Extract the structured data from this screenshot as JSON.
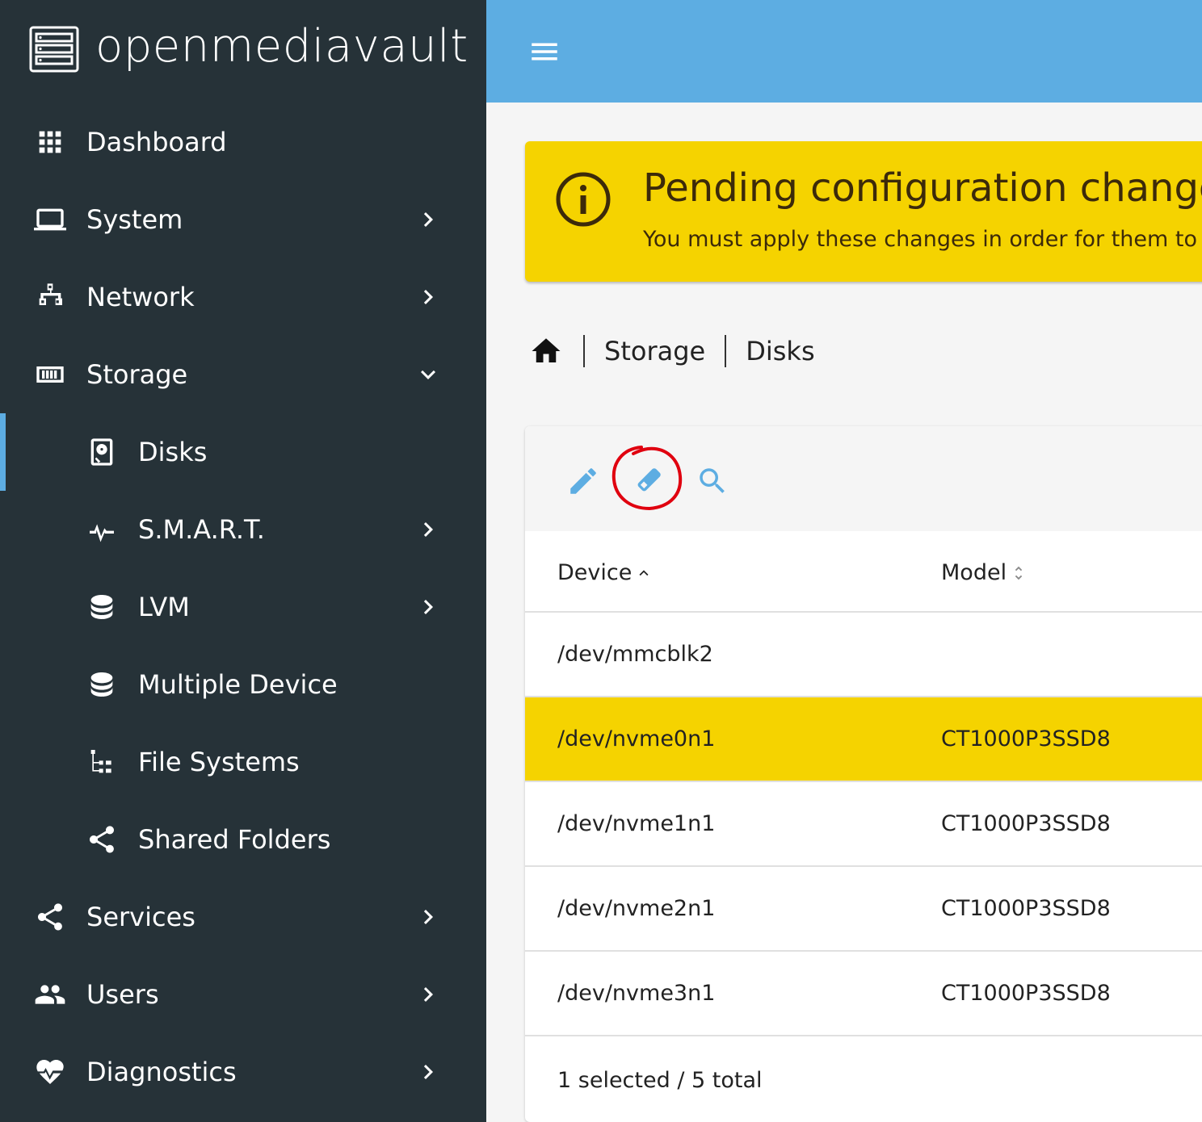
{
  "brand": {
    "name": "openmediavault"
  },
  "sidebar": {
    "items": [
      {
        "label": "Dashboard",
        "icon": "dashboard-icon"
      },
      {
        "label": "System",
        "icon": "laptop-icon"
      },
      {
        "label": "Network",
        "icon": "network-icon"
      },
      {
        "label": "Storage",
        "icon": "storage-icon"
      },
      {
        "label": "Disks",
        "icon": "disk-icon"
      },
      {
        "label": "S.M.A.R.T.",
        "icon": "pulse-icon"
      },
      {
        "label": "LVM",
        "icon": "database-icon"
      },
      {
        "label": "Multiple Device",
        "icon": "database-icon"
      },
      {
        "label": "File Systems",
        "icon": "file-tree-icon"
      },
      {
        "label": "Shared Folders",
        "icon": "share-icon"
      },
      {
        "label": "Services",
        "icon": "share-icon"
      },
      {
        "label": "Users",
        "icon": "users-icon"
      },
      {
        "label": "Diagnostics",
        "icon": "heart-pulse-icon"
      }
    ]
  },
  "alert": {
    "title": "Pending configuration changes",
    "message": "You must apply these changes in order for them to take effect."
  },
  "breadcrumb": {
    "items": [
      "Storage",
      "Disks"
    ]
  },
  "toolbar": {
    "icons": [
      "pencil-icon",
      "eraser-icon",
      "search-icon"
    ],
    "highlighted": "eraser-icon",
    "highlight_color": "#e0000f"
  },
  "table": {
    "columns": [
      "Device",
      "Model"
    ],
    "sort": {
      "column": "Device",
      "direction": "asc"
    },
    "rows": [
      {
        "device": "/dev/mmcblk2",
        "model": "",
        "selected": false
      },
      {
        "device": "/dev/nvme0n1",
        "model": "CT1000P3SSD8",
        "selected": true
      },
      {
        "device": "/dev/nvme1n1",
        "model": "CT1000P3SSD8",
        "selected": false
      },
      {
        "device": "/dev/nvme2n1",
        "model": "CT1000P3SSD8",
        "selected": false
      },
      {
        "device": "/dev/nvme3n1",
        "model": "CT1000P3SSD8",
        "selected": false
      }
    ],
    "footer": "1 selected / 5 total"
  },
  "colors": {
    "sidebar": "#263238",
    "topbar": "#5dade2",
    "accent": "#5dade2",
    "warning": "#f5d300"
  }
}
